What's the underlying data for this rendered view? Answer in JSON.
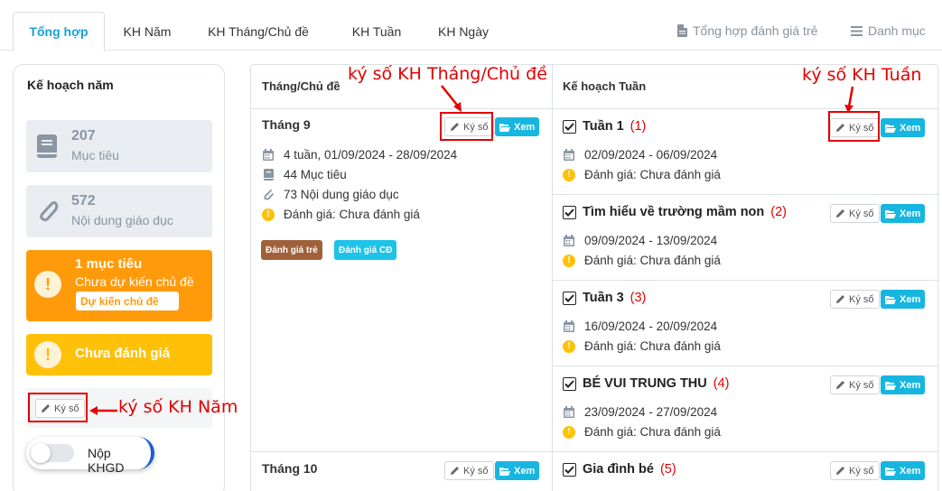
{
  "tabs": [
    {
      "label": "Tổng hợp",
      "active": true
    },
    {
      "label": "KH Năm"
    },
    {
      "label": "KH Tháng/Chủ đề"
    },
    {
      "label": "KH Tuần"
    },
    {
      "label": "KH Ngày"
    }
  ],
  "tabs_right": [
    {
      "label": "Tổng hợp đánh giá trẻ",
      "icon": "document-icon"
    },
    {
      "label": "Danh mục",
      "icon": "menu-icon"
    }
  ],
  "sidebar": {
    "title": "Kế hoạch năm",
    "stats": [
      {
        "number": "207",
        "label": "Mục tiêu",
        "icon": "book-icon"
      },
      {
        "number": "572",
        "label": "Nội dung giáo dục",
        "icon": "paperclip-icon"
      }
    ],
    "warning_orange": {
      "title": "1 mục tiêu",
      "subtitle": "Chưa dự kiến chủ đề",
      "button": "Dự kiến chủ đề"
    },
    "warning_yellow": {
      "title": "Chưa đánh giá"
    },
    "sign_button": "Ký số",
    "toggle_label": "Nộp KHGD",
    "toggle_on": false
  },
  "table": {
    "col1_header": "Tháng/Chủ đề",
    "col2_header": "Kế hoạch Tuần",
    "sign_label": "Ký số",
    "view_label": "Xem",
    "months": [
      {
        "title": "Tháng 9",
        "weeks_range": "4 tuần, 01/09/2024 - 28/09/2024",
        "goals": "44 Mục tiêu",
        "contents": "73 Nội dung giáo dục",
        "evaluation": "Đánh giá: Chưa đánh giá",
        "badges": [
          "Đánh giá trẻ",
          "Đánh giá CĐ"
        ]
      },
      {
        "title": "Tháng 10"
      }
    ],
    "weeks": [
      {
        "title": "Tuần 1",
        "num": "(1)",
        "dates": "02/09/2024 - 06/09/2024",
        "evaluation": "Đánh giá: Chưa đánh giá"
      },
      {
        "title": "Tìm hiểu về trường mầm non",
        "num": "(2)",
        "dates": "09/09/2024 - 13/09/2024",
        "evaluation": "Đánh giá: Chưa đánh giá"
      },
      {
        "title": "Tuần 3",
        "num": "(3)",
        "dates": "16/09/2024 - 20/09/2024",
        "evaluation": "Đánh giá: Chưa đánh giá"
      },
      {
        "title": "BÉ VUI TRUNG THU",
        "num": "(4)",
        "dates": "23/09/2024 - 27/09/2024",
        "evaluation": "Đánh giá: Chưa đánh giá"
      },
      {
        "title": "Gia đình bé",
        "num": "(5)"
      }
    ]
  },
  "annotations": {
    "month_sign": "ký số KH Tháng/Chủ đề",
    "week_sign": "ký số KH Tuần",
    "year_sign": "ký số KH Năm"
  },
  "colors": {
    "accent": "#1aa2d6",
    "orange": "#ff9a0a",
    "yellow": "#ffc107",
    "badge_brown": "#a0613a",
    "badge_cyan": "#1ec3e8",
    "view_button": "#17b6e0",
    "annotation_red": "#e30000"
  }
}
